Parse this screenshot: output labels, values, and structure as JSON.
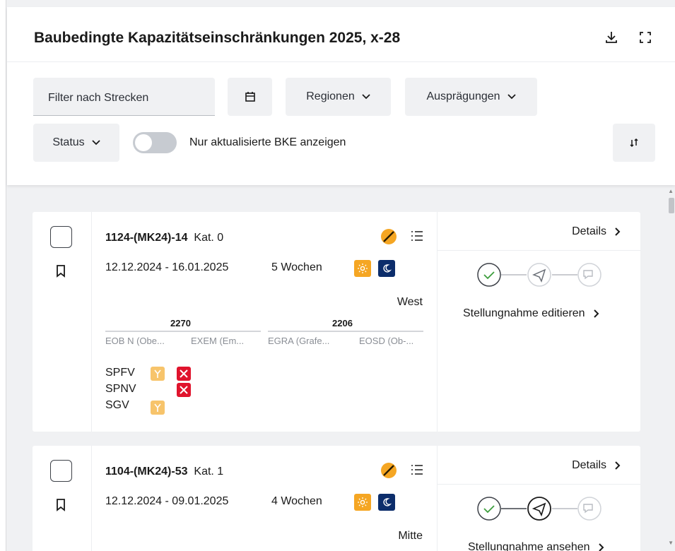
{
  "header": {
    "title": "Baubedingte Kapazitätseinschränkungen 2025, x-28",
    "icons": [
      "download-icon",
      "fullscreen-icon"
    ]
  },
  "filters": {
    "strecken_placeholder": "Filter nach Strecken",
    "regionen": "Regionen",
    "auspraegungen": "Ausprägungen",
    "status": "Status",
    "toggle_label": "Nur aktualisierte BKE anzeigen",
    "toggle_on": false
  },
  "cards": [
    {
      "id": "1124-(MK24)-14",
      "kat": "Kat. 0",
      "dates": "12.12.2024 - 16.01.2025",
      "weeks": "5 Wochen",
      "region": "West",
      "details": "Details",
      "statement": "Stellungnahme editieren",
      "stations": [
        {
          "num": "2270",
          "from": "EOB N (Obe...",
          "to": "EXEM (Em..."
        },
        {
          "num": "2206",
          "from": "EGRA (Grafe...",
          "to": "EOSD (Ob-..."
        }
      ],
      "traffic": [
        "SPFV",
        "SPNV",
        "SGV"
      ]
    },
    {
      "id": "1104-(MK24)-53",
      "kat": "Kat. 1",
      "dates": "12.12.2024 - 09.01.2025",
      "weeks": "4 Wochen",
      "region": "Mitte",
      "details": "Details",
      "statement": "Stellungnahme ansehen"
    }
  ],
  "colors": {
    "accent_orange": "#f5a623",
    "night_blue": "#0c2d6b",
    "cancel_red": "#e0142d",
    "fork_yellow": "#f7c46b",
    "step_green": "#3c9d3c"
  }
}
